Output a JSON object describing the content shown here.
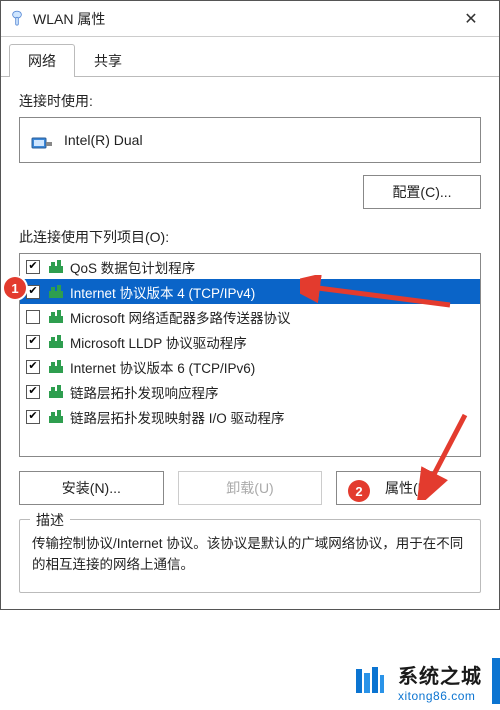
{
  "window": {
    "title": "WLAN 属性",
    "close_glyph": "✕"
  },
  "tabs": [
    {
      "label": "网络",
      "active": true
    },
    {
      "label": "共享",
      "active": false
    }
  ],
  "connect_using_label": "连接时使用:",
  "adapter_name": "Intel(R) Dual",
  "configure_btn": "配置(C)...",
  "items_label": "此连接使用下列项目(O):",
  "items": [
    {
      "checked": true,
      "selected": false,
      "label": "QoS 数据包计划程序"
    },
    {
      "checked": true,
      "selected": true,
      "label": "Internet 协议版本 4 (TCP/IPv4)"
    },
    {
      "checked": false,
      "selected": false,
      "label": "Microsoft 网络适配器多路传送器协议"
    },
    {
      "checked": true,
      "selected": false,
      "label": "Microsoft LLDP 协议驱动程序"
    },
    {
      "checked": true,
      "selected": false,
      "label": "Internet 协议版本 6 (TCP/IPv6)"
    },
    {
      "checked": true,
      "selected": false,
      "label": "链路层拓扑发现响应程序"
    },
    {
      "checked": true,
      "selected": false,
      "label": "链路层拓扑发现映射器 I/O 驱动程序"
    }
  ],
  "buttons": {
    "install": "安装(N)...",
    "uninstall": "卸载(U)",
    "properties": "属性(R)"
  },
  "desc_legend": "描述",
  "desc_text": "传输控制协议/Internet 协议。该协议是默认的广域网络协议，用于在不同的相互连接的网络上通信。",
  "annotations": {
    "badge1": "1",
    "badge2": "2"
  },
  "watermark": {
    "main": "系统之城",
    "sub": "xitong86.com"
  },
  "colors": {
    "selection": "#0a64c8",
    "badge": "#e33b2e",
    "arrow": "#e33b2e",
    "brand": "#0b74d1"
  }
}
